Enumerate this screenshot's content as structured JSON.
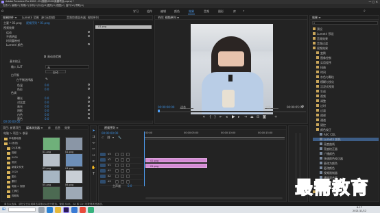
{
  "titlebar": {
    "title": "Adobe Premiere Pro 2020 - D:\\视频\\0000\\新建项目.prproj *"
  },
  "menubar": {
    "items": [
      "文件(F)",
      "编辑(E)",
      "剪辑(C)",
      "序列(S)",
      "标记(M)",
      "图形(G)",
      "视图(V)",
      "窗口(W)",
      "帮助(H)"
    ]
  },
  "workspaces": {
    "items": [
      "学习",
      "组件",
      "编辑",
      "颜色",
      "效果",
      "音频",
      "图形",
      "库"
    ],
    "active": "效果"
  },
  "effect_controls": {
    "tabs": [
      "效果控件 ≡",
      "Lumetri 范围",
      "源:(无剪辑)",
      "音频剪辑混合器: 视频序列"
    ],
    "source_label": "主要 * 01.png",
    "seq_label": "视频序列 * 01.png",
    "section_video": "视频效果",
    "fx_motion": "运动",
    "fx_opacity": "不透明度",
    "fx_time": "时间重映射",
    "fx_lumetri": "Lumetri 颜色",
    "checkbox_label": "高动态范围",
    "basic": "基本校正",
    "input_lut_label": "输入 LUT",
    "input_lut": "无",
    "auto": "自动",
    "wb": "白平衡",
    "wb_picker": "白平衡选择器",
    "temp": "色温",
    "temp_v": "0.0",
    "tint": "色彩",
    "tint_v": "0.0",
    "tone": "色调",
    "exposure": "曝光",
    "exposure_v": "0.0",
    "contrast": "对比度",
    "contrast_v": "0.0",
    "highlights": "高光",
    "highlights_v": "0.0",
    "shadows": "阴影",
    "shadows_v": "0.0",
    "whites": "白色",
    "whites_v": "0.0",
    "blacks": "黑色",
    "blacks_v": "0.0",
    "timecode": "00:00:00:00",
    "clip_name": "01.png"
  },
  "program": {
    "tab": "节目: 视频序列 ≡",
    "timecode_left": "00:00:00:00",
    "fit": "适合",
    "quality": "完整",
    "timecode_right": "00:00:05:00"
  },
  "project": {
    "tabs": [
      "项目: 新建项目",
      "媒体浏览器 ≡",
      "库",
      "信息",
      "效果"
    ],
    "path": "电脑 > 项目 > 收录",
    "tree": [
      "本地驱动器",
      "C:(系统)",
      "D:(本地)",
      "视频",
      "0000",
      "测试",
      "新建文件夹",
      "2020",
      "图片",
      "素材",
      "电脑 > 视频",
      "工具栏",
      "视频库"
    ],
    "thumbs": [
      "01.png",
      "02.png",
      "03.png",
      "04.png",
      "05.png",
      "06.png",
      "07.png",
      "08.png"
    ]
  },
  "timeline": {
    "tab": "视频序列 ≡",
    "timecode": "00:00:00:00",
    "ruler": [
      "00:00",
      "00:00:05:00",
      "00:00:10:00",
      "00:00:15:00"
    ],
    "tracks": [
      "V3",
      "V2",
      "V1",
      "A1",
      "A2",
      "A3"
    ],
    "master": "主声道",
    "master_v": "0.0",
    "clips": [
      "02.png",
      "01.png"
    ]
  },
  "effects_panel": {
    "tab": "效果 ≡",
    "items": [
      "预设",
      "Lumetri 预设",
      "音频效果",
      "音频过渡",
      "视频效果",
      "变换",
      "图像控制",
      "实用程序",
      "扭曲",
      "时间",
      "杂色与颗粒",
      "模糊与锐化",
      "沉浸式视频",
      "生成",
      "视频",
      "调整",
      "过时",
      "过渡",
      "透视",
      "通道",
      "键控",
      "颜色校正",
      "ASC CDL",
      "Lumetri 颜色",
      "亮度曲线",
      "亮度校正器",
      "广播颜色",
      "快速颜色校正器",
      "更改为颜色",
      "更改颜色",
      "视频限制器",
      "通道混合器",
      "颜色平衡",
      "风格化",
      "视频过渡"
    ],
    "selected": "Lumetri 颜色"
  },
  "statusbar": {
    "text": "单击以选择，或在空白区域单击并拖动以进行框选。使用 Shift、Alt 和 Ctrl 可获得其他选项。"
  },
  "taskbar": {
    "time": "8:17",
    "date": "2021/11/12"
  },
  "watermark": {
    "text": "最需教育"
  }
}
